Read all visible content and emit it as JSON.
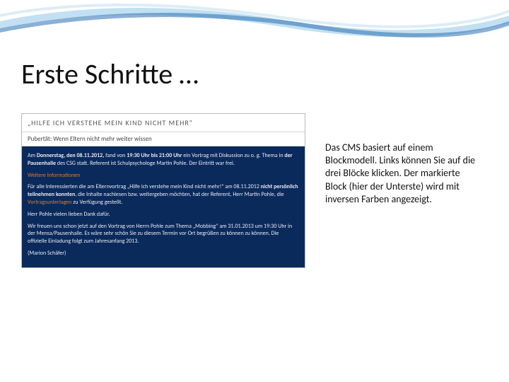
{
  "title": "Erste Schritte …",
  "cms": {
    "header": "„HILFE ICH VERSTEHE MEIN KIND NICHT MEHR\"",
    "subheader": "Pubertät: Wenn Eltern nicht mehr weiter wissen",
    "block": {
      "line1_pre": "Am ",
      "line1_b1": "Donnerstag, den 08.11.2012,",
      "line1_mid": " fand von ",
      "line1_b2": "19:30 Uhr bis 21:00 Uhr",
      "line1_post": " ein Vortrag mit Diskussion zu o. g. Thema in ",
      "line1_b3": "der Pausenhalle",
      "line1_end": " des CSG statt. Referent ist Schulpsychologe Martin Pohle. Der Eintritt war frei.",
      "link": "Weitere Informationen",
      "line2_pre": "Für alle Interessierten die am Elternvortrag „Hilfe ich verstehe mein Kind nicht mehr!\" am 08.11.2012 ",
      "line2_b1": "nicht persönlich teilnehmen konnten",
      "line2_post": ", die Inhalte nachlesen bzw. weitergeben möchten, hat der Referent, Herr Martin Pohle, die ",
      "line2_span": "Vortragsunterlagen",
      "line2_end": " zu Verfügung gestellt.",
      "line3": "Herr Pohle vielen lieben Dank dafür.",
      "line4": "Wir freuen uns schon jetzt auf den Vortrag von Herrn Pohle zum Thema „Mobbing\" am 31.01.2013 um 19:30 Uhr in der Mensa/Pausenhalle. Es wäre sehr schön Sie zu diesem Termin vor Ort begrüßen zu können zu können. Die offizielle Einladung folgt zum Jahresanfang 2013.",
      "line5": "(Marion Schäfer)"
    }
  },
  "desc": "Das CMS basiert auf einem Blockmodell. Links können Sie auf die drei Blöcke klicken. Der markierte Block (hier der Unterste) wird mit inversen Farben angezeigt."
}
